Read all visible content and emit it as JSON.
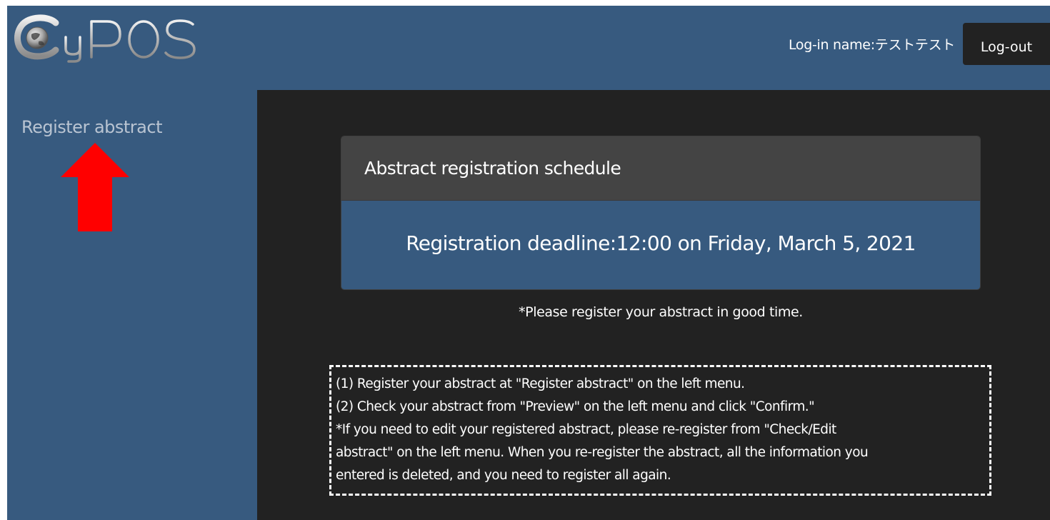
{
  "header": {
    "logo_text": "CyPOS",
    "login_name": "Log-in name:テストテスト",
    "logout_label": "Log-out"
  },
  "sidebar": {
    "items": [
      {
        "label": "Register abstract"
      }
    ]
  },
  "annotation": {
    "arrow_color": "#ff0000",
    "arrow_direction": "up"
  },
  "main": {
    "schedule": {
      "title": "Abstract registration schedule",
      "deadline": "Registration deadline:12:00 on Friday, March 5, 2021"
    },
    "notice": "*Please register your abstract in good time.",
    "instructions": [
      "(1) Register your abstract at \"Register abstract\" on the left menu.",
      "(2) Check your abstract from \"Preview\" on the left menu and click \"Confirm.\"",
      "*If you need to edit your registered abstract, please re-register from \"Check/Edit",
      "abstract\" on the left menu. When you re-register the abstract, all the information you",
      "entered is deleted, and you need to register all again."
    ]
  },
  "colors": {
    "primary": "#375a7f",
    "dark": "#222222",
    "card_header": "#444444",
    "text": "#ffffff",
    "sidebar_link": "#b9c4d2"
  }
}
